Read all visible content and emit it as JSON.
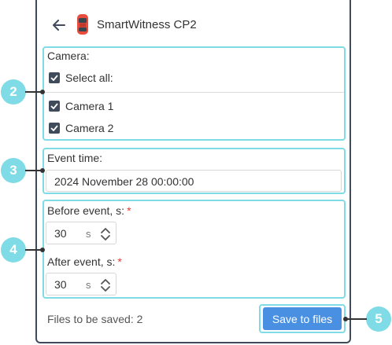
{
  "header": {
    "title": "SmartWitness CP2"
  },
  "camera_section": {
    "label": "Camera:",
    "select_all_label": "Select all:",
    "select_all_checked": true,
    "cameras": [
      {
        "label": "Camera 1",
        "checked": true
      },
      {
        "label": "Camera 2",
        "checked": true
      }
    ]
  },
  "event_time": {
    "label": "Event time:",
    "value": "2024 November 28 00:00:00"
  },
  "before_event": {
    "label": "Before event, s:",
    "required_mark": "*",
    "value": "30",
    "unit": "s"
  },
  "after_event": {
    "label": "After event, s:",
    "required_mark": "*",
    "value": "30",
    "unit": "s"
  },
  "footer": {
    "files_label": "Files to be saved: 2",
    "save_button": "Save to files"
  },
  "callouts": {
    "c2": "2",
    "c3": "3",
    "c4": "4",
    "c5": "5"
  },
  "colors": {
    "accent": "#4a90e2",
    "highlight": "#7fdbe6",
    "border": "#3f4b5b",
    "required": "#e53935"
  },
  "icons": {
    "back": "arrow-left-icon",
    "vehicle": "car-icon",
    "checkbox": "checkmark-icon",
    "spinner": "chevron-up-down-icon"
  }
}
